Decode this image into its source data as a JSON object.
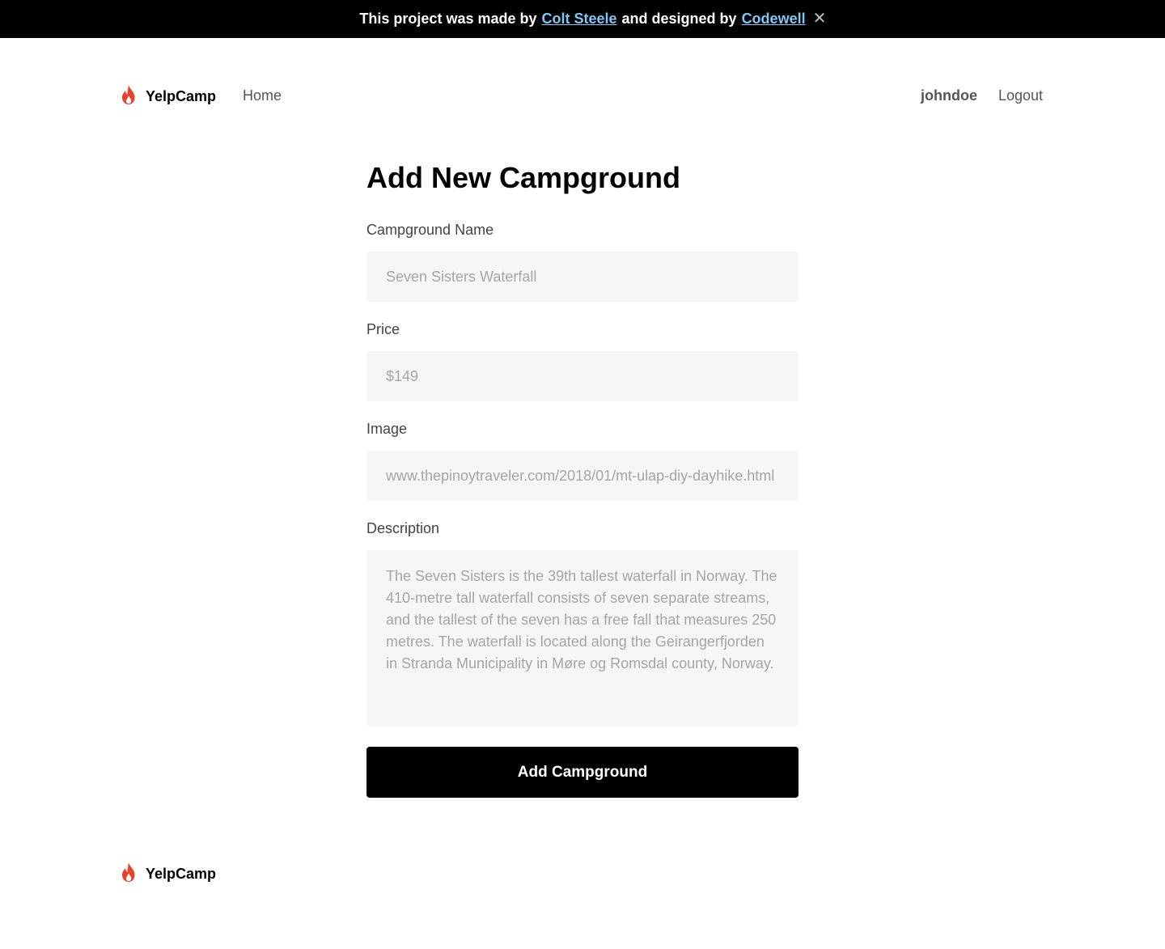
{
  "banner": {
    "prefix": "This project was made by",
    "author_link": "Colt Steele",
    "middle": "and designed by",
    "designer_link": "Codewell",
    "close_glyph": "✕"
  },
  "nav": {
    "brand": "YelpCamp",
    "home": "Home",
    "username": "johndoe",
    "logout": "Logout"
  },
  "form": {
    "title": "Add New Campground",
    "name_label": "Campground Name",
    "name_placeholder": "Seven Sisters Waterfall",
    "price_label": "Price",
    "price_placeholder": "$149",
    "image_label": "Image",
    "image_placeholder": "www.thepinoytraveler.com/2018/01/mt-ulap-diy-dayhike.html",
    "description_label": "Description",
    "description_placeholder": "The Seven Sisters is the 39th tallest waterfall in Norway. The 410-metre tall waterfall consists of seven separate streams, and the tallest of the seven has a free fall that measures 250 metres. The waterfall is located along the Geirangerfjorden in Stranda Municipality in Møre og Romsdal county, Norway.",
    "submit": "Add Campground"
  },
  "footer": {
    "brand": "YelpCamp"
  },
  "colors": {
    "banner_bg": "#000000",
    "link": "#7cc8f5",
    "flame": "#e8412c",
    "field_bg": "#f6f6f6",
    "button_bg": "#000000"
  },
  "icons": {
    "logo": "flame-icon",
    "banner_close": "close-icon"
  }
}
